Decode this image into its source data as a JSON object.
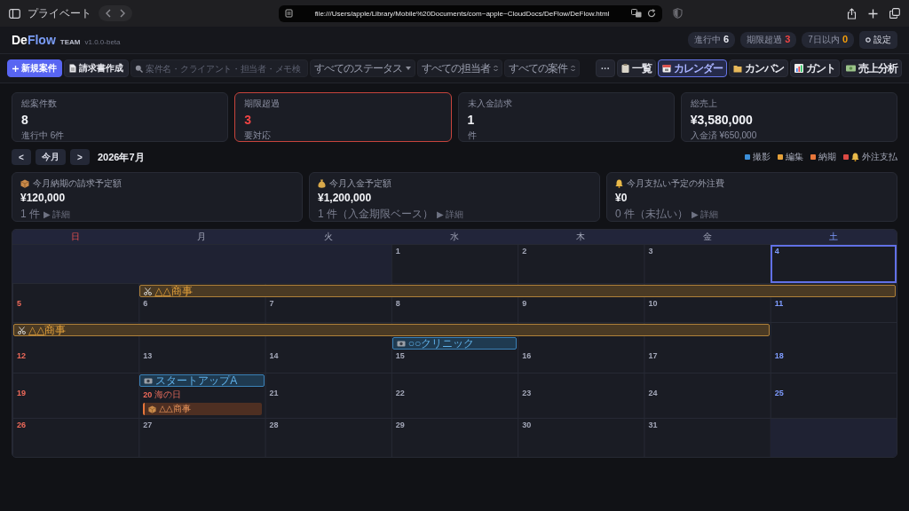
{
  "browser": {
    "private_label": "プライベート",
    "url": "file:///Users/apple/Library/Mobile%20Documents/com~apple~CloudDocs/DeFlow/DeFlow.html"
  },
  "app": {
    "logo_lead": "De",
    "logo_accent": "Flow",
    "edition": "TEAM",
    "version": "v1.0.0-beta",
    "badges": [
      {
        "label": "進行中",
        "count": "6",
        "color": "#e8e9f0"
      },
      {
        "label": "期限超過",
        "count": "3",
        "color": "#ef4444"
      },
      {
        "label": "7日以内",
        "count": "0",
        "color": "#f59e0b"
      }
    ],
    "settings": "設定"
  },
  "toolbar": {
    "new_button": "新規案件",
    "invoice_button": "請求書作成",
    "search": {
      "placeholder": "案件名・クライアント・担当者・メモ検"
    },
    "filters": [
      {
        "value": "すべてのステータス",
        "kind": "dropdown"
      },
      {
        "value": "すべての担当者",
        "kind": "stepper"
      },
      {
        "value": "すべての案件",
        "kind": "stepper"
      }
    ],
    "more": "···",
    "views": [
      {
        "label": "一覧",
        "kind": "list",
        "selected": false
      },
      {
        "label": "カレンダー",
        "kind": "calendar",
        "selected": true
      },
      {
        "label": "カンバン",
        "kind": "kanban",
        "selected": false
      },
      {
        "label": "ガント",
        "kind": "gantt",
        "selected": false
      },
      {
        "label": "売上分析",
        "kind": "sales",
        "selected": false
      }
    ]
  },
  "kpis": [
    {
      "label": "総案件数",
      "value": "8",
      "note": "進行中 6件",
      "alert": false
    },
    {
      "label": "期限超過",
      "value": "3",
      "note": "要対応",
      "alert": true
    },
    {
      "label": "未入金請求",
      "value": "1",
      "note": "件",
      "alert": false
    },
    {
      "label": "総売上",
      "value": "¥3,580,000",
      "note": "入金済 ¥650,000",
      "alert": false
    }
  ],
  "calendar": {
    "prev": "<",
    "today_button": "今月",
    "next": ">",
    "month": "2026年7月",
    "legend": [
      {
        "label": "撮影",
        "kind": "shoot",
        "color": "#3b8fd9"
      },
      {
        "label": "編集",
        "kind": "edit",
        "color": "#e5a13a"
      },
      {
        "label": "納期",
        "kind": "deadline",
        "color": "#e8763a"
      },
      {
        "label": "外注支払",
        "kind": "payment",
        "color": "#dc4a44"
      }
    ],
    "summaries": [
      {
        "kind": "billing",
        "label": "今月納期の請求予定額",
        "value": "¥120,000",
        "note": "1 件",
        "link": "▶ 詳細"
      },
      {
        "kind": "income",
        "label": "今月入金予定額",
        "value": "¥1,200,000",
        "note": "1 件（入金期限ベース）",
        "link": "▶ 詳細"
      },
      {
        "kind": "outsourcing",
        "label": "今月支払い予定の外注費",
        "value": "¥0",
        "note": "0 件（未払い）",
        "link": "▶ 詳細"
      }
    ],
    "weekdays": [
      "日",
      "月",
      "火",
      "水",
      "木",
      "金",
      "土"
    ],
    "weeks": [
      {
        "days": [
          {
            "outside": true,
            "today": false
          },
          {
            "outside": true,
            "today": false
          },
          {
            "outside": true,
            "today": false
          },
          {
            "date": "1",
            "outside": false,
            "today": false
          },
          {
            "date": "2",
            "outside": false,
            "today": false
          },
          {
            "date": "3",
            "outside": false,
            "today": false
          },
          {
            "date": "4",
            "outside": false,
            "today": true
          }
        ]
      },
      {
        "days": [
          {
            "date": "5",
            "outside": false,
            "today": false
          },
          {
            "date": "6",
            "outside": false,
            "today": false,
            "bars": [
              {
                "kind": "edit",
                "label": "△△商事"
              }
            ]
          },
          {
            "date": "7",
            "outside": false,
            "today": false,
            "bars": [
              {
                "kind": "edit"
              }
            ]
          },
          {
            "date": "8",
            "outside": false,
            "today": false,
            "bars": [
              {
                "kind": "edit"
              }
            ]
          },
          {
            "date": "9",
            "outside": false,
            "today": false,
            "bars": [
              {
                "kind": "edit"
              }
            ]
          },
          {
            "date": "10",
            "outside": false,
            "today": false,
            "bars": [
              {
                "kind": "edit"
              }
            ]
          },
          {
            "date": "11",
            "outside": false,
            "today": false,
            "bars": [
              {
                "kind": "edit"
              }
            ]
          }
        ]
      },
      {
        "days": [
          {
            "date": "12",
            "outside": false,
            "today": false,
            "bars": [
              {
                "kind": "edit",
                "label": "△△商事"
              }
            ]
          },
          {
            "date": "13",
            "outside": false,
            "today": false,
            "bars": [
              {
                "kind": "edit"
              }
            ]
          },
          {
            "date": "14",
            "outside": false,
            "today": false,
            "bars": [
              {
                "kind": "edit"
              }
            ]
          },
          {
            "date": "15",
            "outside": false,
            "today": false,
            "bars": [
              {
                "kind": "edit"
              },
              {
                "kind": "shoot",
                "label": "○○クリニック"
              }
            ]
          },
          {
            "date": "16",
            "outside": false,
            "today": false,
            "bars": [
              {
                "kind": "edit"
              }
            ]
          },
          {
            "date": "17",
            "outside": false,
            "today": false,
            "bars": [
              {
                "kind": "edit"
              }
            ]
          },
          {
            "date": "18",
            "outside": false,
            "today": false
          }
        ]
      },
      {
        "days": [
          {
            "date": "19",
            "outside": false,
            "today": false
          },
          {
            "date": "20",
            "outside": false,
            "today": false,
            "holiday": "海の日",
            "bars": [
              {
                "kind": "shoot",
                "label": "スタートアップA"
              }
            ],
            "events": [
              {
                "label": "△△商事",
                "kind": "deadline"
              }
            ]
          },
          {
            "date": "21",
            "outside": false,
            "today": false
          },
          {
            "date": "22",
            "outside": false,
            "today": false
          },
          {
            "date": "23",
            "outside": false,
            "today": false
          },
          {
            "date": "24",
            "outside": false,
            "today": false
          },
          {
            "date": "25",
            "outside": false,
            "today": false
          }
        ]
      },
      {
        "days": [
          {
            "date": "26",
            "outside": false,
            "today": false
          },
          {
            "date": "27",
            "outside": false,
            "today": false
          },
          {
            "date": "28",
            "outside": false,
            "today": false
          },
          {
            "date": "29",
            "outside": false,
            "today": false
          },
          {
            "date": "30",
            "outside": false,
            "today": false
          },
          {
            "date": "31",
            "outside": false,
            "today": false
          },
          {
            "outside": true,
            "today": false
          }
        ]
      }
    ]
  }
}
